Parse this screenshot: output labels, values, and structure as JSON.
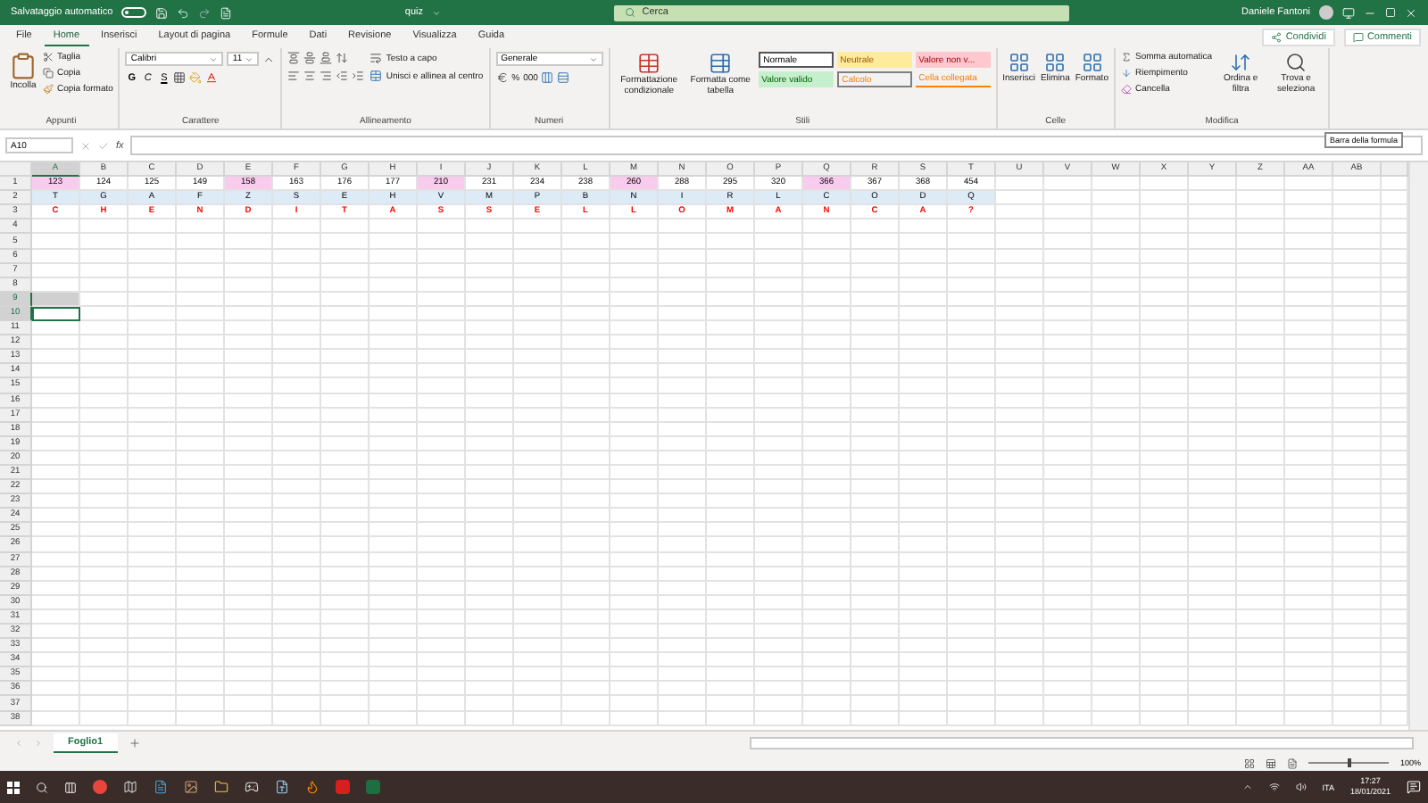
{
  "title_bar": {
    "autosave_label": "Salvataggio automatico",
    "autosave_on": false,
    "file_name": "quiz",
    "search_placeholder": "Cerca",
    "user_name": "Daniele Fantoni"
  },
  "menu_tabs": [
    {
      "label": "File",
      "selected": false
    },
    {
      "label": "Home",
      "selected": true
    },
    {
      "label": "Inserisci",
      "selected": false
    },
    {
      "label": "Layout di pagina",
      "selected": false
    },
    {
      "label": "Formule",
      "selected": false
    },
    {
      "label": "Dati",
      "selected": false
    },
    {
      "label": "Revisione",
      "selected": false
    },
    {
      "label": "Visualizza",
      "selected": false
    },
    {
      "label": "Guida",
      "selected": false
    }
  ],
  "share_buttons": [
    "Condividi",
    "Commenti"
  ],
  "ribbon": {
    "appunti": {
      "label": "Appunti",
      "paste": "Incolla",
      "cut": "Taglia",
      "copy": "Copia",
      "format_painter": "Copia formato"
    },
    "carattere": {
      "label": "Carattere",
      "font": "Calibri",
      "size": "11",
      "bold": "G",
      "italic": "C",
      "underline": "S"
    },
    "allineamento": {
      "label": "Allineamento",
      "wrap": "Testo a capo",
      "merge": "Unisci e allinea al centro"
    },
    "numeri": {
      "label": "Numeri",
      "format": "Generale",
      "percent": "%",
      "thousands": "000"
    },
    "stili": {
      "label": "Stili",
      "conditional": "Formattazione condizionale",
      "table": "Formatta come tabella",
      "styles": [
        {
          "label": "Normale",
          "kind": "normal"
        },
        {
          "label": "Neutrale",
          "kind": "neutral"
        },
        {
          "label": "Valore non v...",
          "kind": "bad"
        },
        {
          "label": "Valore valido",
          "kind": "good"
        },
        {
          "label": "Calcolo",
          "kind": "calc"
        },
        {
          "label": "Cella collegata",
          "kind": "linked"
        }
      ]
    },
    "celle": {
      "label": "Celle",
      "buttons": [
        "Inserisci",
        "Elimina",
        "Formato"
      ]
    },
    "modifica": {
      "label": "Modifica",
      "autosum": "Somma automatica",
      "fill": "Riempimento",
      "clear": "Cancella",
      "sort": "Ordina e filtra",
      "find": "Trova e seleziona"
    }
  },
  "formula_bar": {
    "name_box": "A10",
    "function_label": "fx",
    "tooltip": "Barra della formula"
  },
  "sheet": {
    "columns": [
      {
        "label": "A",
        "selected": true
      },
      {
        "label": "B",
        "selected": false
      },
      {
        "label": "C",
        "selected": false
      },
      {
        "label": "D",
        "selected": false
      },
      {
        "label": "E",
        "selected": false
      },
      {
        "label": "F",
        "selected": false
      },
      {
        "label": "G",
        "selected": false
      },
      {
        "label": "H",
        "selected": false
      },
      {
        "label": "I",
        "selected": false
      },
      {
        "label": "J",
        "selected": false
      },
      {
        "label": "K",
        "selected": false
      },
      {
        "label": "L",
        "selected": false
      },
      {
        "label": "M",
        "selected": false
      },
      {
        "label": "N",
        "selected": false
      },
      {
        "label": "O",
        "selected": false
      },
      {
        "label": "P",
        "selected": false
      },
      {
        "label": "Q",
        "selected": false
      },
      {
        "label": "R",
        "selected": false
      },
      {
        "label": "S",
        "selected": false
      },
      {
        "label": "T",
        "selected": false
      },
      {
        "label": "U",
        "selected": false
      },
      {
        "label": "V",
        "selected": false
      },
      {
        "label": "W",
        "selected": false
      },
      {
        "label": "X",
        "selected": false
      },
      {
        "label": "Y",
        "selected": false
      },
      {
        "label": "Z",
        "selected": false
      },
      {
        "label": "AA",
        "selected": false
      },
      {
        "label": "AB",
        "selected": false
      }
    ],
    "rows": [
      {
        "label": "1",
        "selected": false,
        "kind": "numbers",
        "cells": [
          {
            "text": "123",
            "highlighted": true
          },
          {
            "text": "124",
            "highlighted": false
          },
          {
            "text": "125",
            "highlighted": false
          },
          {
            "text": "149",
            "highlighted": false
          },
          {
            "text": "158",
            "highlighted": true
          },
          {
            "text": "163",
            "highlighted": false
          },
          {
            "text": "176",
            "highlighted": false
          },
          {
            "text": "177",
            "highlighted": false
          },
          {
            "text": "210",
            "highlighted": true
          },
          {
            "text": "231",
            "highlighted": false
          },
          {
            "text": "234",
            "highlighted": false
          },
          {
            "text": "238",
            "highlighted": false
          },
          {
            "text": "260",
            "highlighted": true
          },
          {
            "text": "288",
            "highlighted": false
          },
          {
            "text": "295",
            "highlighted": false
          },
          {
            "text": "320",
            "highlighted": false
          },
          {
            "text": "366",
            "highlighted": true
          },
          {
            "text": "367",
            "highlighted": false
          },
          {
            "text": "368",
            "highlighted": false
          },
          {
            "text": "454",
            "highlighted": false
          }
        ]
      },
      {
        "label": "2",
        "selected": false,
        "kind": "band",
        "cells": [
          "T",
          "G",
          "A",
          "F",
          "Z",
          "S",
          "E",
          "H",
          "V",
          "M",
          "P",
          "B",
          "N",
          "I",
          "R",
          "L",
          "C",
          "O",
          "D",
          "Q"
        ]
      },
      {
        "label": "3",
        "selected": false,
        "kind": "red",
        "cells": [
          "C",
          "H",
          "E",
          "N",
          "D",
          "I",
          "T",
          "A",
          "S",
          "S",
          "E",
          "L",
          "L",
          "O",
          "M",
          "A",
          "N",
          "C",
          "A",
          "?"
        ]
      },
      {
        "label": "4",
        "selected": false
      },
      {
        "label": "5",
        "selected": false
      },
      {
        "label": "6",
        "selected": false
      },
      {
        "label": "7",
        "selected": false
      },
      {
        "label": "8",
        "selected": false
      },
      {
        "label": "9",
        "selected": true
      },
      {
        "label": "10",
        "selected": true
      },
      {
        "label": "11",
        "selected": false
      },
      {
        "label": "12",
        "selected": false
      },
      {
        "label": "13",
        "selected": false
      },
      {
        "label": "14",
        "selected": false
      },
      {
        "label": "15",
        "selected": false
      },
      {
        "label": "16",
        "selected": false
      },
      {
        "label": "17",
        "selected": false
      },
      {
        "label": "18",
        "selected": false
      },
      {
        "label": "19",
        "selected": false
      },
      {
        "label": "20",
        "selected": false
      },
      {
        "label": "21",
        "selected": false
      },
      {
        "label": "22",
        "selected": false
      },
      {
        "label": "23",
        "selected": false
      },
      {
        "label": "24",
        "selected": false
      },
      {
        "label": "25",
        "selected": false
      },
      {
        "label": "26",
        "selected": false
      },
      {
        "label": "27",
        "selected": false
      },
      {
        "label": "28",
        "selected": false
      },
      {
        "label": "29",
        "selected": false
      },
      {
        "label": "30",
        "selected": false
      },
      {
        "label": "31",
        "selected": false
      },
      {
        "label": "32",
        "selected": false
      },
      {
        "label": "33",
        "selected": false
      },
      {
        "label": "34",
        "selected": false
      },
      {
        "label": "35",
        "selected": false
      },
      {
        "label": "36",
        "selected": false
      },
      {
        "label": "37",
        "selected": false
      },
      {
        "label": "38",
        "selected": false
      }
    ]
  },
  "sheet_tabs": [
    {
      "label": "Foglio1",
      "selected": true
    }
  ],
  "status_bar": {
    "zoom": "100%",
    "level": 0.5
  },
  "taskbar": {
    "language": "ITA",
    "time": "17:27",
    "date": "18/01/2021"
  }
}
